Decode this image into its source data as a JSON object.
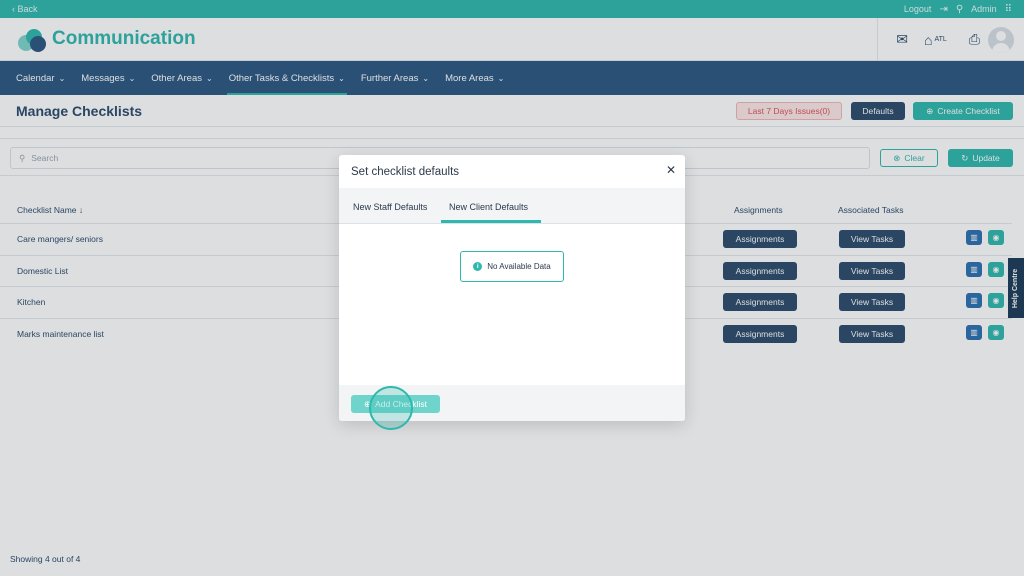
{
  "topbar": {
    "back_label": "‹ Back",
    "logout_label": "Logout",
    "user_label": "Admin"
  },
  "header": {
    "app_title": "Communication",
    "location_code": "ATL"
  },
  "nav": {
    "items": [
      {
        "label": "Calendar"
      },
      {
        "label": "Messages"
      },
      {
        "label": "Other Areas"
      },
      {
        "label": "Other Tasks & Checklists"
      },
      {
        "label": "Further Areas"
      },
      {
        "label": "More Areas"
      }
    ]
  },
  "page": {
    "title": "Manage Checklists",
    "issues_label": "Last 7 Days Issues(0)",
    "defaults_label": "Defaults",
    "create_label": "Create Checklist"
  },
  "search": {
    "placeholder": "Search",
    "clear_label": "Clear",
    "update_label": "Update"
  },
  "table": {
    "headers": {
      "name": "Checklist Name",
      "assignments": "Assignments",
      "tasks": "Associated Tasks"
    },
    "assign_btn": "Assignments",
    "tasks_btn": "View Tasks",
    "rows": [
      {
        "name": "Care mangers/ seniors"
      },
      {
        "name": "Domestic List"
      },
      {
        "name": "Kitchen"
      },
      {
        "name": "Marks maintenance list"
      }
    ]
  },
  "help_label": "Help Centre",
  "footer": {
    "showing": "Showing 4 out of 4"
  },
  "modal": {
    "title": "Set checklist defaults",
    "tab_staff": "New Staff Defaults",
    "tab_client": "New Client Defaults",
    "no_data": "No Available Data",
    "add_label": "Add Checklist"
  },
  "colors": {
    "teal": "#2fb8ad",
    "navy": "#2c5880",
    "dark": "#2c4a6a",
    "danger": "#e05050"
  }
}
